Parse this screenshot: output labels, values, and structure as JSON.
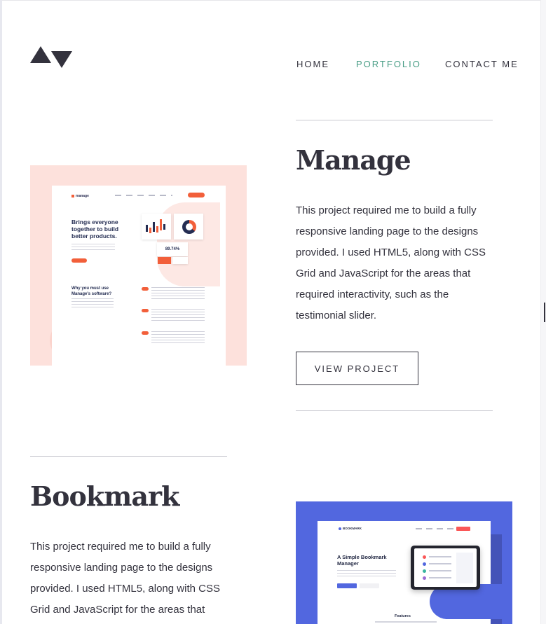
{
  "header": {
    "logo_name": "site-logo",
    "nav": [
      {
        "label": "HOME",
        "active": false
      },
      {
        "label": "PORTFOLIO",
        "active": true
      },
      {
        "label": "CONTACT ME",
        "active": false
      }
    ]
  },
  "colors": {
    "text": "#33323d",
    "nav_active": "#4a9e86",
    "rule": "#c8c8cf",
    "manage_bg": "#fde1dc",
    "bookmark_bg": "#5267df"
  },
  "projects": [
    {
      "title": "Manage",
      "description": "This project required me to build a fully responsive landing page to the designs provided. I used HTML5, along with CSS Grid and JavaScript for the areas that required interactivity, such as the testimonial slider.",
      "button_label": "VIEW PROJECT",
      "thumbnail": {
        "logo": "manage",
        "headline": "Brings everyone together to build better products.",
        "stat": "89.74%",
        "subheadline": "Why you must use Manage's software?"
      }
    },
    {
      "title": "Bookmark",
      "description": "This project required me to build a fully responsive landing page to the designs provided. I used HTML5, along with CSS Grid and JavaScript for the areas that",
      "thumbnail": {
        "logo": "BOOKMARK",
        "headline": "A Simple Bookmark Manager",
        "section": "Features"
      }
    }
  ]
}
